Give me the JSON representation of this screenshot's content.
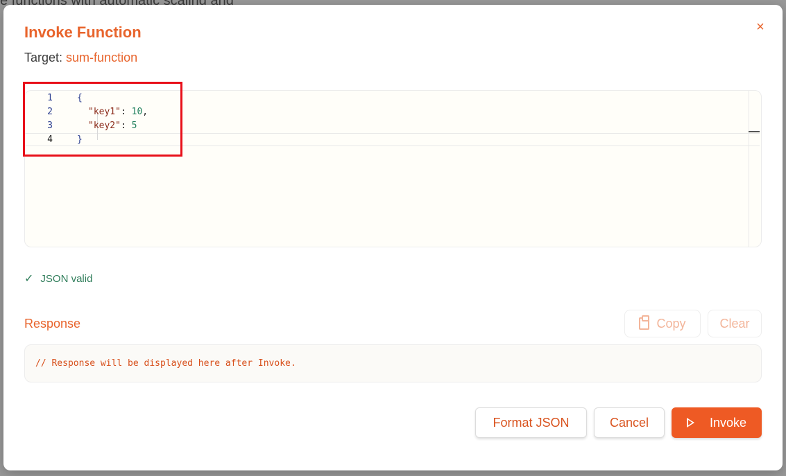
{
  "background": {
    "fragment_text": "e functions with automatic scaling and"
  },
  "modal": {
    "title": "Invoke Function",
    "target_label": "Target:",
    "target_name": "sum-function",
    "close_symbol": "×"
  },
  "editor": {
    "lines": [
      {
        "num": "1",
        "content": "{"
      },
      {
        "num": "2",
        "key": "\"key1\"",
        "sep": ": ",
        "value": "10",
        "trail": ","
      },
      {
        "num": "3",
        "key": "\"key2\"",
        "sep": ": ",
        "value": "5",
        "trail": ""
      },
      {
        "num": "4",
        "content": "}"
      }
    ]
  },
  "validation": {
    "status": "JSON valid",
    "icon": "check-icon"
  },
  "response": {
    "title": "Response",
    "copy_label": "Copy",
    "clear_label": "Clear",
    "placeholder": "// Response will be displayed here after Invoke."
  },
  "actions": {
    "format_label": "Format JSON",
    "cancel_label": "Cancel",
    "invoke_label": "Invoke"
  },
  "colors": {
    "accent": "#e8642c",
    "invoke_bg": "#ee5a24",
    "valid": "#2f7d5a",
    "highlight": "#e8101a"
  }
}
